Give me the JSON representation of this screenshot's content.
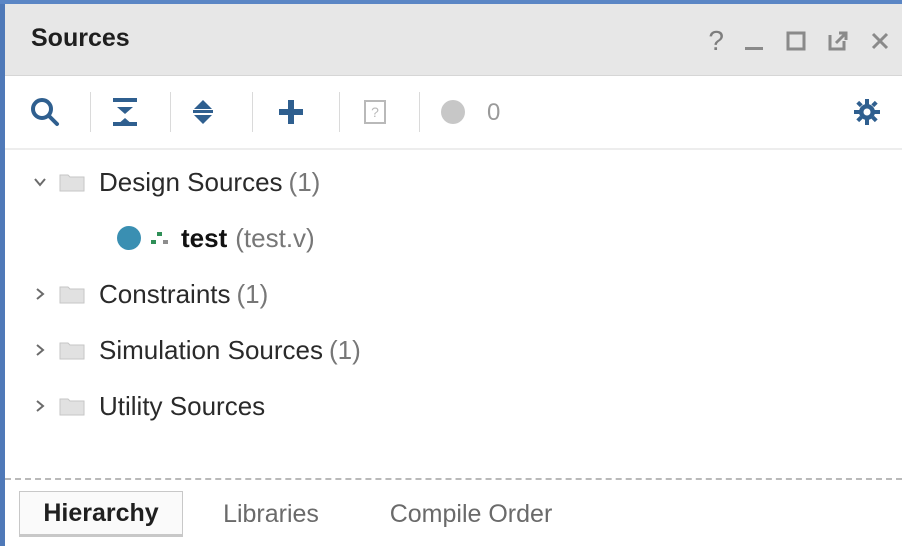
{
  "panel": {
    "title": "Sources",
    "controls": {
      "help_label": "?",
      "minimize_icon": "minimize-icon",
      "maximize_icon": "maximize-icon",
      "float_icon": "float-icon",
      "close_icon": "close-icon"
    }
  },
  "toolbar": {
    "search_icon": "search-icon",
    "collapse_all_icon": "collapse-all-icon",
    "expand_all_icon": "expand-all-icon",
    "add_icon": "plus-icon",
    "unknown_icon": "question-box-icon",
    "status_count": "0",
    "settings_icon": "gear-icon"
  },
  "tree": {
    "design_sources": {
      "label": "Design Sources",
      "count": "(1)"
    },
    "design_file": {
      "name": "test",
      "file": "(test.v)"
    },
    "constraints": {
      "label": "Constraints",
      "count": "(1)"
    },
    "simulation_sources": {
      "label": "Simulation Sources",
      "count": "(1)"
    },
    "utility_sources": {
      "label": "Utility Sources"
    }
  },
  "tabs": [
    {
      "label": "Hierarchy"
    },
    {
      "label": "Libraries"
    },
    {
      "label": "Compile Order"
    }
  ],
  "colors": {
    "accent": "#4f79b8",
    "title_bg": "#e7e7e7",
    "file_status": "#3a8fb2"
  }
}
